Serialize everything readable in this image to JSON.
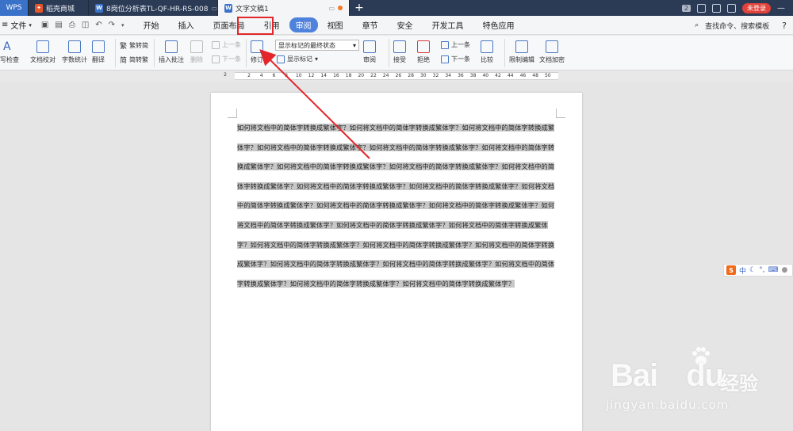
{
  "titlebar": {
    "tabs": [
      {
        "label": "WPS",
        "icon": "wps-logo-icon"
      },
      {
        "label": "稻壳商城",
        "icon": "docer-flame-icon"
      },
      {
        "label": "8岗位分析表TL-QF-HR-RS-008",
        "icon": "writer-doc-icon"
      },
      {
        "label": "文字文稿1",
        "icon": "writer-doc-icon",
        "active": true
      }
    ],
    "new_tab": "+",
    "badge": "2",
    "login": "未登录"
  },
  "menubar": {
    "file": "文件",
    "items": [
      "开始",
      "插入",
      "页面布局",
      "引用",
      "审阅",
      "视图",
      "章节",
      "安全",
      "开发工具",
      "特色应用"
    ],
    "active": "审阅",
    "search": "查找命令、搜索模板",
    "help": "?"
  },
  "ribbon": {
    "spell": "写检查",
    "proof": "文档校对",
    "wordcount": "字数统计",
    "translate": "翻译",
    "trad": "繁转简",
    "simp": "简转繁",
    "insert_comment": "插入批注",
    "delete": "删除",
    "prev_comment": "上一条",
    "next_comment": "下一条",
    "revise": "修订",
    "display_state": "显示标记的最终状态",
    "show_marks": "显示标记",
    "review": "审阅",
    "accept": "接受",
    "reject": "拒绝",
    "prev": "上一条",
    "next": "下一条",
    "compare": "比较",
    "restrict": "限制编辑",
    "encrypt": "文档加密"
  },
  "ruler": {
    "left": "2",
    "numbers": [
      "2",
      "4",
      "6",
      "8",
      "10",
      "12",
      "14",
      "16",
      "18",
      "20",
      "22",
      "24",
      "26",
      "28",
      "30",
      "32",
      "34",
      "36",
      "38",
      "40",
      "42",
      "44",
      "46",
      "48",
      "50"
    ]
  },
  "document": {
    "text": "如何将文档中的简体字转换成繁体字？如何将文档中的简体字转换成繁体字？如何将文档中的简体字转换成繁体字？如何将文档中的简体字转换成繁体字？如何将文档中的简体字转换成繁体字？如何将文档中的简体字转换成繁体字？如何将文档中的简体字转换成繁体字？如何将文档中的简体字转换成繁体字？如何将文档中的简体字转换成繁体字？如何将文档中的简体字转换成繁体字？如何将文档中的简体字转换成繁体字？如何将文档中的简体字转换成繁体字？如何将文档中的简体字转换成繁体字？如何将文档中的简体字转换成繁体字？如何将文档中的简体字转换成繁体字？如何将文档中的简体字转换成繁体字？如何将文档中的简体字转换成繁体字？如何将文档中的简体字转换成繁体字？如何将文档中的简体字转换成繁体字？如何将文档中的简体字转换成繁体字？如何将文档中的简体字转换成繁体字？如何将文档中的简体字转换成繁体字？如何将文档中的简体字转换成繁体字？如何将文档中的简体字转换成繁体字？如何将文档中的简体字转换成繁体字？"
  },
  "ime": {
    "logo": "S",
    "mode": "中"
  },
  "watermark": {
    "brand": "Bai",
    "brand2": "du",
    "cn": "经验",
    "url": "jingyan.baidu.com"
  },
  "colors": {
    "titlebar": "#2b3a55",
    "active_pill": "#4f82dc",
    "highlight_box": "#e2262b",
    "arrow": "#e2262b",
    "selection": "#c8c8c8"
  }
}
